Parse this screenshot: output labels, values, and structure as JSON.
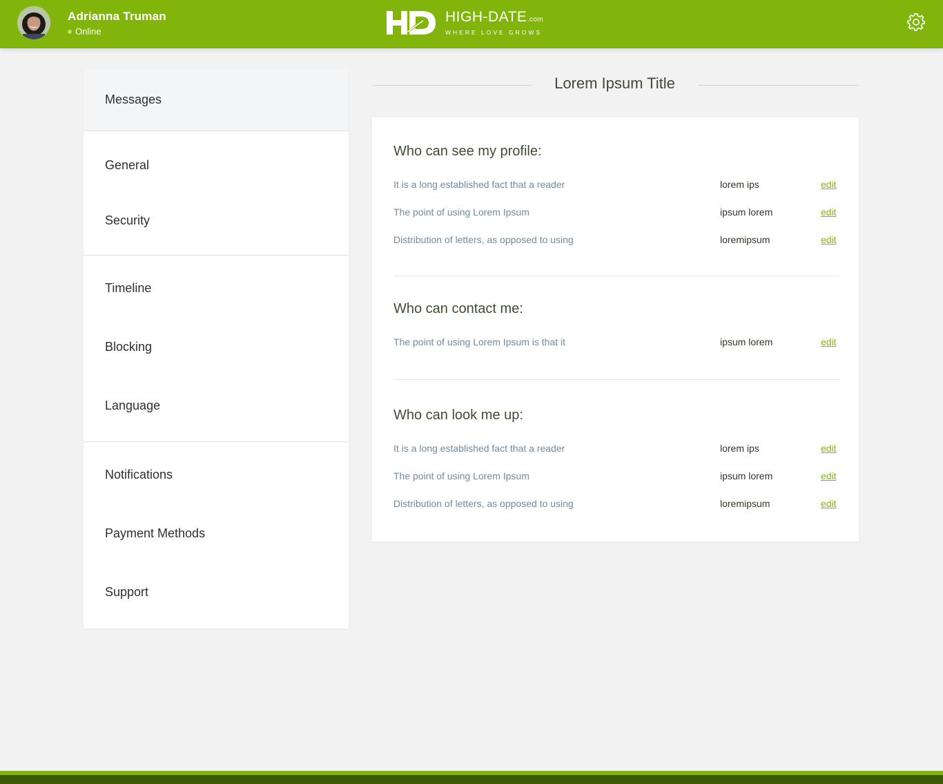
{
  "header": {
    "user_name": "Adrianna Truman",
    "status": "Online",
    "logo_initials": "HD",
    "logo_main": "HIGH-DATE",
    "logo_domain": ".com",
    "logo_tagline": "WHERE LOVE GROWS",
    "settings_icon": "gear-icon",
    "brand_color": "#82b50c"
  },
  "sidebar": {
    "items": [
      {
        "label": "Messages",
        "active": true
      },
      {
        "label": "General"
      },
      {
        "label": "Security"
      },
      {
        "label": "Timeline"
      },
      {
        "label": "Blocking"
      },
      {
        "label": "Language"
      },
      {
        "label": "Notifications"
      },
      {
        "label": "Payment Methods"
      },
      {
        "label": "Support"
      }
    ]
  },
  "main": {
    "title": "Lorem Ipsum Title",
    "sections": [
      {
        "title": "Who can see my profile:",
        "rows": [
          {
            "label": "It is a long established fact that a reader",
            "value": "lorem ips",
            "action": "edit"
          },
          {
            "label": "The point of using Lorem Ipsum",
            "value": "ipsum lorem",
            "action": "edit"
          },
          {
            "label": "Distribution of letters, as opposed to using",
            "value": "loremipsum",
            "action": "edit"
          }
        ]
      },
      {
        "title": "Who can contact me:",
        "rows": [
          {
            "label": "The point of using Lorem Ipsum is that it",
            "value": "ipsum lorem",
            "action": "edit"
          }
        ]
      },
      {
        "title": "Who can look me up:",
        "rows": [
          {
            "label": "It is a long established fact that a reader",
            "value": "lorem ips",
            "action": "edit"
          },
          {
            "label": "The point of using Lorem Ipsum",
            "value": "ipsum lorem",
            "action": "edit"
          },
          {
            "label": "Distribution of letters, as opposed to using",
            "value": "loremipsum",
            "action": "edit"
          }
        ]
      }
    ]
  }
}
